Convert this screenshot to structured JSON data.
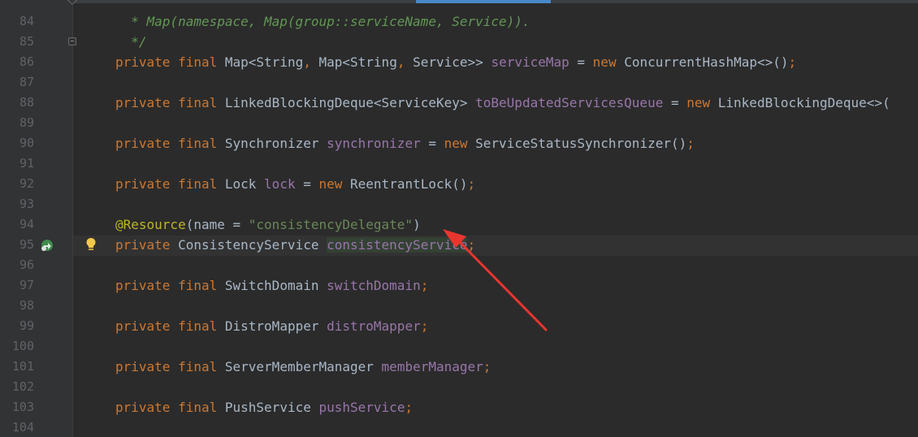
{
  "editor": {
    "lines": [
      {
        "num": "84",
        "tokens": [
          {
            "t": "* Map(namespace, Map(group::serviceName, Service)).",
            "c": "cm"
          }
        ],
        "indent": "  "
      },
      {
        "num": "85",
        "tokens": [
          {
            "t": "*/",
            "c": "cm"
          }
        ],
        "indent": "  "
      },
      {
        "num": "86",
        "tokens": [
          {
            "t": "private",
            "c": "kw"
          },
          {
            "t": " "
          },
          {
            "t": "final",
            "c": "kw"
          },
          {
            "t": " Map<String"
          },
          {
            "t": ",",
            "c": "kw"
          },
          {
            "t": " Map<String"
          },
          {
            "t": ",",
            "c": "kw"
          },
          {
            "t": " Service>> "
          },
          {
            "t": "serviceMap",
            "c": "fld"
          },
          {
            "t": " = "
          },
          {
            "t": "new",
            "c": "kw"
          },
          {
            "t": " ConcurrentHashMap<>()"
          },
          {
            "t": ";",
            "c": "kw"
          }
        ]
      },
      {
        "num": "87",
        "tokens": []
      },
      {
        "num": "88",
        "tokens": [
          {
            "t": "private",
            "c": "kw"
          },
          {
            "t": " "
          },
          {
            "t": "final",
            "c": "kw"
          },
          {
            "t": " LinkedBlockingDeque<ServiceKey> "
          },
          {
            "t": "toBeUpdatedServicesQueue",
            "c": "fld"
          },
          {
            "t": " = "
          },
          {
            "t": "new",
            "c": "kw"
          },
          {
            "t": " LinkedBlockingDeque<>("
          }
        ]
      },
      {
        "num": "89",
        "tokens": []
      },
      {
        "num": "90",
        "tokens": [
          {
            "t": "private",
            "c": "kw"
          },
          {
            "t": " "
          },
          {
            "t": "final",
            "c": "kw"
          },
          {
            "t": " Synchronizer "
          },
          {
            "t": "synchronizer",
            "c": "fld"
          },
          {
            "t": " = "
          },
          {
            "t": "new",
            "c": "kw"
          },
          {
            "t": " ServiceStatusSynchronizer()"
          },
          {
            "t": ";",
            "c": "kw"
          }
        ]
      },
      {
        "num": "91",
        "tokens": []
      },
      {
        "num": "92",
        "tokens": [
          {
            "t": "private",
            "c": "kw"
          },
          {
            "t": " "
          },
          {
            "t": "final",
            "c": "kw"
          },
          {
            "t": " Lock "
          },
          {
            "t": "lock",
            "c": "fld"
          },
          {
            "t": " = "
          },
          {
            "t": "new",
            "c": "kw"
          },
          {
            "t": " ReentrantLock()"
          },
          {
            "t": ";",
            "c": "kw"
          }
        ]
      },
      {
        "num": "93",
        "tokens": []
      },
      {
        "num": "94",
        "tokens": [
          {
            "t": "@Resource",
            "c": "ann"
          },
          {
            "t": "(name = "
          },
          {
            "t": "\"consistencyDelegate\"",
            "c": "str"
          },
          {
            "t": ")"
          }
        ]
      },
      {
        "num": "95",
        "tokens": [
          {
            "t": "private",
            "c": "kw"
          },
          {
            "t": " ConsistencyService "
          },
          {
            "t": "consistencyService",
            "c": "fld hl"
          },
          {
            "t": ";",
            "c": "kw"
          }
        ]
      },
      {
        "num": "96",
        "tokens": []
      },
      {
        "num": "97",
        "tokens": [
          {
            "t": "private",
            "c": "kw"
          },
          {
            "t": " "
          },
          {
            "t": "final",
            "c": "kw"
          },
          {
            "t": " SwitchDomain "
          },
          {
            "t": "switchDomain",
            "c": "fld"
          },
          {
            "t": ";",
            "c": "kw"
          }
        ]
      },
      {
        "num": "98",
        "tokens": []
      },
      {
        "num": "99",
        "tokens": [
          {
            "t": "private",
            "c": "kw"
          },
          {
            "t": " "
          },
          {
            "t": "final",
            "c": "kw"
          },
          {
            "t": " DistroMapper "
          },
          {
            "t": "distroMapper",
            "c": "fld"
          },
          {
            "t": ";",
            "c": "kw"
          }
        ]
      },
      {
        "num": "100",
        "tokens": []
      },
      {
        "num": "101",
        "tokens": [
          {
            "t": "private",
            "c": "kw"
          },
          {
            "t": " "
          },
          {
            "t": "final",
            "c": "kw"
          },
          {
            "t": " ServerMemberManager "
          },
          {
            "t": "memberManager",
            "c": "fld"
          },
          {
            "t": ";",
            "c": "kw"
          }
        ]
      },
      {
        "num": "102",
        "tokens": []
      },
      {
        "num": "103",
        "tokens": [
          {
            "t": "private",
            "c": "kw"
          },
          {
            "t": " "
          },
          {
            "t": "final",
            "c": "kw"
          },
          {
            "t": " PushService "
          },
          {
            "t": "pushService",
            "c": "fld"
          },
          {
            "t": ";",
            "c": "kw"
          }
        ]
      },
      {
        "num": "104",
        "tokens": []
      }
    ]
  },
  "icons": {
    "gutter_icon": "implemented-override-icon",
    "bulb_icon": "intention-bulb-icon",
    "annotation_arrow": "red-arrow"
  },
  "colors": {
    "background": "#2b2b2b",
    "keyword": "#cc7832",
    "field": "#9876aa",
    "string": "#6a8759",
    "comment": "#629755",
    "annotation": "#bbb529",
    "arrow": "#e8362f"
  }
}
